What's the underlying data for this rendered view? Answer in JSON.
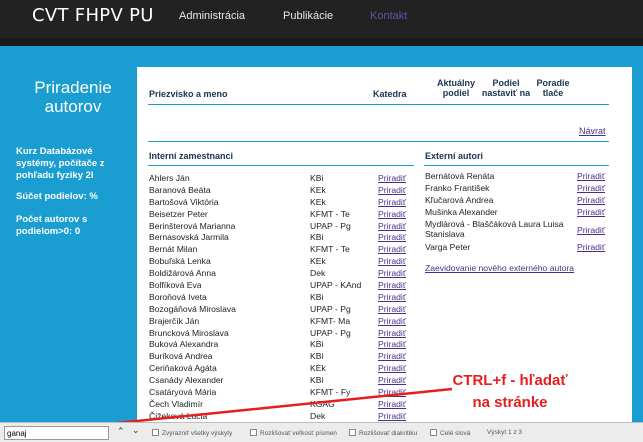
{
  "navbar": {
    "brand": "CVT FHPV PU",
    "links": [
      "Administrácia",
      "Publikácie",
      "Kontakt"
    ]
  },
  "sidebar": {
    "title": "Priradenie autorov",
    "course": "Kurz Databázové systémy, počítače z pohľadu fyziky 2l",
    "sum_label": "Súčet podielov: %",
    "count_label": "Počet autorov s podielom>0: 0"
  },
  "table_header": {
    "name": "Priezvisko a meno",
    "dept": "Katedra",
    "share": "Aktuálny podiel",
    "set_share": "Podiel nastaviť na",
    "order": "Poradie tlače"
  },
  "back_link": "Návrat",
  "internal": {
    "title": "Interní zamestnanci",
    "action": "Priradiť",
    "rows": [
      {
        "name": "Ahlers Ján",
        "dept": "KBi"
      },
      {
        "name": "Baranová Beáta",
        "dept": "KEk"
      },
      {
        "name": "Bartošová Viktória",
        "dept": "KEk"
      },
      {
        "name": "Beisetzer Peter",
        "dept": "KFMT - Te"
      },
      {
        "name": "Berinšterová Marianna",
        "dept": "UPAP - Pg"
      },
      {
        "name": "Bernasovská Jarmila",
        "dept": "KBi"
      },
      {
        "name": "Bernát Milan",
        "dept": "KFMT - Te"
      },
      {
        "name": "Bobuľská Lenka",
        "dept": "KEk"
      },
      {
        "name": "Boldižárová Anna",
        "dept": "Dek"
      },
      {
        "name": "Bolfíková Eva",
        "dept": "UPAP - KAnd"
      },
      {
        "name": "Boroňová Iveta",
        "dept": "KBi"
      },
      {
        "name": "Bozogáňová Miroslava",
        "dept": "UPAP - Pg"
      },
      {
        "name": "Brajerčík Ján",
        "dept": "KFMT- Ma"
      },
      {
        "name": "Bruncková Miroslava",
        "dept": "UPAP - Pg"
      },
      {
        "name": "Buková Alexandra",
        "dept": "KBi"
      },
      {
        "name": "Buríková Andrea",
        "dept": "KBi"
      },
      {
        "name": "Ceriňaková Agáta",
        "dept": "KEk"
      },
      {
        "name": "Csanády Alexander",
        "dept": "KBi"
      },
      {
        "name": "Csatáryová Mária",
        "dept": "KFMT - Fy"
      },
      {
        "name": "Čech Vladimír",
        "dept": "KGAG"
      },
      {
        "name": "Čižeková Lucia",
        "dept": "Dek"
      }
    ]
  },
  "external": {
    "title": "Externí autori",
    "action": "Priradiť",
    "rows": [
      {
        "name": "Bernátová Renáta"
      },
      {
        "name": "Franko František"
      },
      {
        "name": "Kľučarová Andrea"
      },
      {
        "name": "Mušinka Alexander"
      },
      {
        "name": "Mydlárová - Blaščáková Laura Luisa Stanislava"
      },
      {
        "name": "Varga Peter"
      }
    ],
    "manage_link": "Zaevidovanie nového externého autora"
  },
  "annotation": {
    "line1": "CTRL+f - hľadať",
    "line2": "na stránke",
    "color": "#e81e1e"
  },
  "findbar": {
    "query": "ganaj",
    "options": [
      "Zvýrazniť všetky výskyty",
      "Rozlišovať veľkosť písmen",
      "Rozlišovať diakritiku",
      "Celé slová"
    ],
    "match_count": "Výskyt 1 z 3"
  }
}
